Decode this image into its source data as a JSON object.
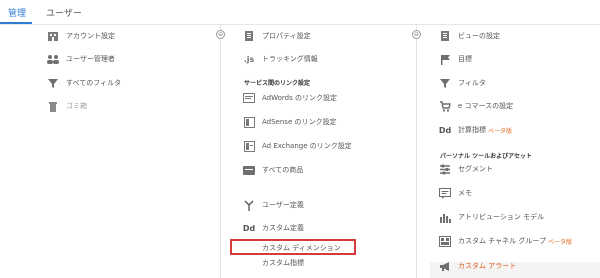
{
  "tabs": {
    "admin": "管理",
    "user": "ユーザー"
  },
  "account": {
    "items": [
      {
        "label": "アカウント設定",
        "icon": "building-icon"
      },
      {
        "label": "ユーザー管理者",
        "icon": "users-icon"
      },
      {
        "label": "すべてのフィルタ",
        "icon": "filter-icon"
      },
      {
        "label": "ゴミ箱",
        "icon": "trash-icon"
      }
    ]
  },
  "property": {
    "items": [
      {
        "label": "プロパティ設定",
        "icon": "document-icon"
      },
      {
        "label": "トラッキング情報",
        "icon": "js-icon"
      }
    ],
    "link_heading": "サービス間のリンク設定",
    "links": [
      {
        "label": "AdWords のリンク設定",
        "icon": "adwords-icon"
      },
      {
        "label": "AdSense のリンク設定",
        "icon": "adsense-icon"
      },
      {
        "label": "Ad Exchange のリンク設定",
        "icon": "adexchange-icon"
      },
      {
        "label": "すべての商品",
        "icon": "products-icon"
      }
    ],
    "custom": [
      {
        "label": "ユーザー定義",
        "icon": "fork-icon"
      },
      {
        "label": "カスタム定義",
        "icon": "dd-icon"
      }
    ],
    "custom_sub": [
      "カスタム ディメンション",
      "カスタム指標"
    ]
  },
  "view": {
    "items": [
      {
        "label": "ビューの設定",
        "icon": "document-icon"
      },
      {
        "label": "目標",
        "icon": "flag-icon"
      },
      {
        "label": "フィルタ",
        "icon": "filter-icon"
      },
      {
        "label": "e コマースの設定",
        "icon": "cart-icon"
      },
      {
        "label": "計算指標",
        "icon": "dd-icon",
        "beta": "ベータ版"
      }
    ],
    "asset_heading": "パーソナル ツールおよびアセット",
    "assets": [
      {
        "label": "セグメント",
        "icon": "segment-icon"
      },
      {
        "label": "メモ",
        "icon": "memo-icon"
      },
      {
        "label": "アトリビューション モデル",
        "icon": "bar-chart-icon"
      },
      {
        "label": "カスタム チャネル グループ",
        "icon": "channel-icon",
        "beta": "ベータ版"
      },
      {
        "label": "カスタム アラート",
        "icon": "megaphone-icon"
      }
    ]
  },
  "colors": {
    "accent": "#2f7bd6",
    "highlight": "#d63b3b",
    "beta": "#e56b1f"
  }
}
